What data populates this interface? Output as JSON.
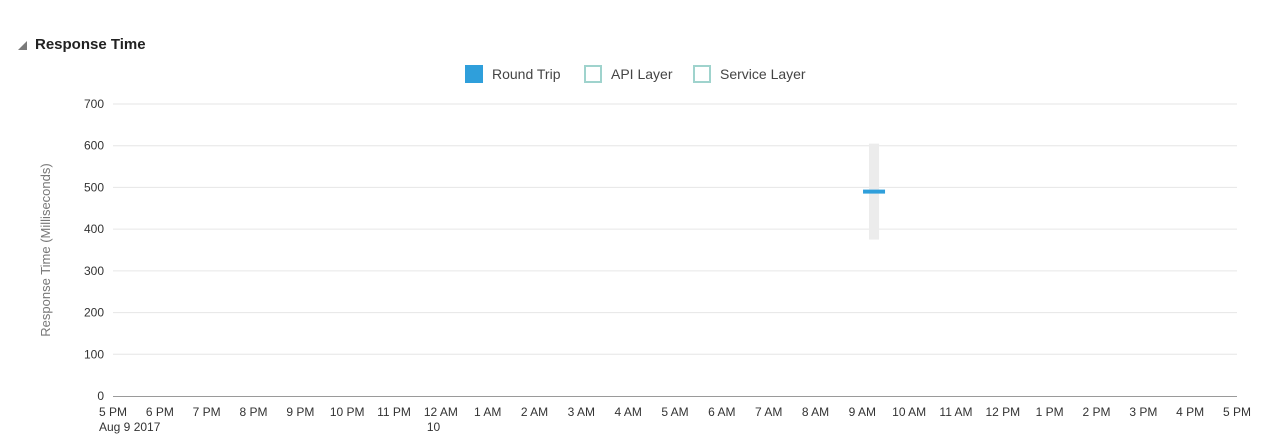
{
  "panel": {
    "title": "Response Time"
  },
  "legend": {
    "items": [
      {
        "label": "Round Trip",
        "color": "#2f9fdb",
        "filled": true
      },
      {
        "label": "API Layer",
        "color": "#9fd3cd",
        "filled": false
      },
      {
        "label": "Service Layer",
        "color": "#9fd3cd",
        "filled": false
      }
    ]
  },
  "chart_data": {
    "type": "bar",
    "ylabel": "Response Time (Milliseconds)",
    "ylim": [
      0,
      700
    ],
    "yticks": [
      0,
      100,
      200,
      300,
      400,
      500,
      600,
      700
    ],
    "grid": true,
    "legend_position": "top",
    "x_ticks": [
      "5 PM",
      "6 PM",
      "7 PM",
      "8 PM",
      "9 PM",
      "10 PM",
      "11 PM",
      "12 AM",
      "1 AM",
      "2 AM",
      "3 AM",
      "4 AM",
      "5 AM",
      "6 AM",
      "7 AM",
      "8 AM",
      "9 AM",
      "10 AM",
      "11 AM",
      "12 PM",
      "1 PM",
      "2 PM",
      "3 PM",
      "4 PM",
      "5 PM"
    ],
    "x_sublabels": [
      {
        "index": 0,
        "text": "Aug 9 2017"
      },
      {
        "index": 7,
        "text": "10"
      }
    ],
    "series": [
      {
        "name": "Round Trip",
        "color": "#2f9fdb",
        "points": [
          {
            "x_index": 16.25,
            "value": 490,
            "low": 375,
            "high": 605
          }
        ]
      }
    ]
  }
}
